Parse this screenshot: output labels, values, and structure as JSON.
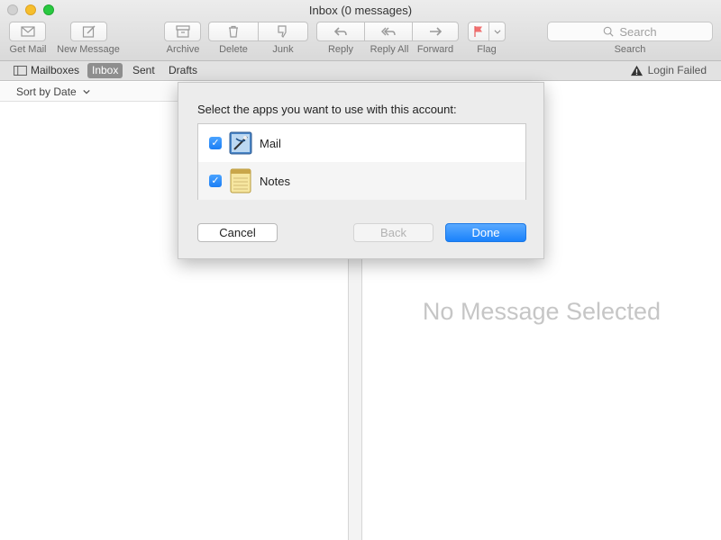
{
  "window": {
    "title": "Inbox (0 messages)"
  },
  "toolbar": {
    "get_mail": "Get Mail",
    "new_message": "New Message",
    "archive": "Archive",
    "delete": "Delete",
    "junk": "Junk",
    "reply": "Reply",
    "reply_all": "Reply All",
    "forward": "Forward",
    "flag": "Flag",
    "search_placeholder": "Search",
    "search_label": "Search"
  },
  "favorites": {
    "mailboxes": "Mailboxes",
    "inbox": "Inbox",
    "sent": "Sent",
    "drafts": "Drafts",
    "status": "Login Failed"
  },
  "list": {
    "sort_label": "Sort by Date"
  },
  "viewer": {
    "empty_text": "No Message Selected"
  },
  "dialog": {
    "title": "Select the apps you want to use with this account:",
    "apps": [
      {
        "name": "Mail",
        "checked": true,
        "icon": "mail-app-icon"
      },
      {
        "name": "Notes",
        "checked": true,
        "icon": "notes-app-icon"
      }
    ],
    "cancel": "Cancel",
    "back": "Back",
    "done": "Done"
  },
  "colors": {
    "accent": "#1a82fb",
    "flag": "#f05a5a"
  }
}
